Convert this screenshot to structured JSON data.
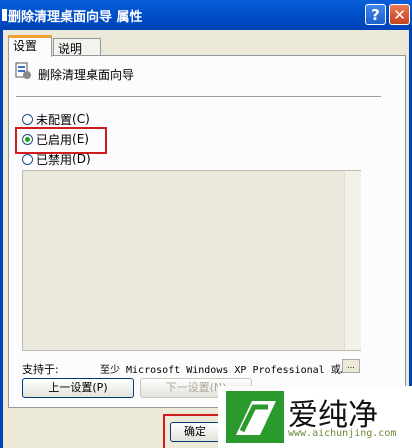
{
  "window": {
    "title": "删除清理桌面向导 属性",
    "help_glyph": "?",
    "close_glyph": "✕"
  },
  "tabs": [
    {
      "label": "设置",
      "active": true
    },
    {
      "label": "说明",
      "active": false
    }
  ],
  "policy": {
    "name": "删除清理桌面向导"
  },
  "options": [
    {
      "label": "未配置",
      "key": "(C)",
      "checked": false
    },
    {
      "label": "已启用",
      "key": "(E)",
      "checked": true
    },
    {
      "label": "已禁用",
      "key": "(D)",
      "checked": false
    }
  ],
  "supported": {
    "label": "支持于:",
    "value": "至少 Microsoft Windows XP Professional 或…",
    "more": "..."
  },
  "buttons": {
    "prev": "上一设置(P)",
    "next": "下一设置(N)",
    "ok": "确定"
  },
  "watermark": {
    "text": "爱纯净",
    "url": "www.aichunjing.com"
  },
  "colors": {
    "title_bar": "#0052cc",
    "highlight": "#d01c1c",
    "radio_dot": "#21a121",
    "watermark_green": "#2a9a2c"
  }
}
